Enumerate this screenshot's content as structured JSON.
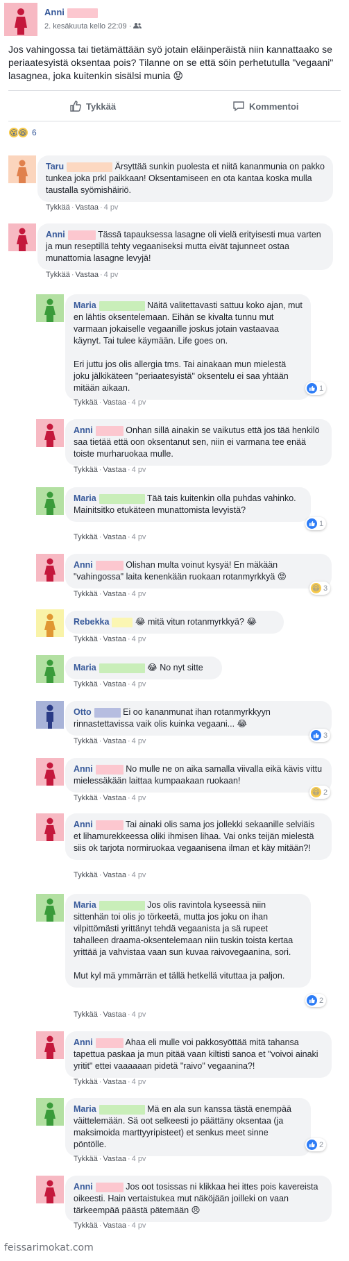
{
  "post": {
    "author": "Anni",
    "meta": "2. kesäkuuta kello 22:09 · ",
    "text": "Jos vahingossa tai tietämättään syö jotain eläinperäistä niin kannattaako se periaatesyistä oksentaa pois? Tilanne on se että söin perhetutulla \"vegaani\" lasagnea, joka kuitenkin sisälsi munia 😟",
    "like_label": "Tykkää",
    "comment_label": "Kommentoi",
    "reaction_count": "6"
  },
  "colors": {
    "link": "#365899",
    "bubble": "#f2f3f5",
    "avatar_female_bg": "#f7b9c3",
    "avatar_female_fig": "#c4183c",
    "avatar_green_bg": "#b3e0a2",
    "avatar_green_fig": "#3a9b3a",
    "avatar_orange_bg": "#fbd5bd",
    "avatar_orange_fig": "#e0814d",
    "avatar_yellow_bg": "#f9f3a8",
    "avatar_yellow_fig": "#e09733",
    "avatar_blue_bg": "#a8b3d8",
    "avatar_blue_fig": "#2a3b86"
  },
  "links": {
    "like": "Tykkää",
    "reply": "Vastaa",
    "sep": "·"
  },
  "comments": [
    {
      "name": "Taru",
      "text": "Ärsyttää sunkin puolesta et niitä kananmunia on pakko tunkea joka prkl paikkaan! Oksentamiseen en ota kantaa koska mulla taustalla syömishäiriö.",
      "age": "4 pv"
    },
    {
      "name": "Anni",
      "text": "Tässä tapauksessa lasagne oli vielä erityisesti mua varten ja mun reseptillä tehty vegaaniseksi mutta eivät tajunneet ostaa munattomia lasagne levyjä!",
      "age": "4 pv"
    },
    {
      "name": "Maria",
      "text": "Näitä valitettavasti sattuu koko ajan, mut en lähtis oksentelemaan. Eihän se kivalta tunnu mut varmaan jokaiselle vegaanille joskus jotain vastaavaa käynyt. Tai tulee käymään. Life goes on.",
      "text2": "Eri juttu jos olis allergia tms. Tai ainakaan mun mielestä joku jälkikäteen \"periaatesyistä\" oksentelu ei saa yhtään mitään aikaan.",
      "age": "4 pv",
      "reactions": "1"
    },
    {
      "name": "Anni",
      "text": "Onhan sillä ainakin se vaikutus että jos tää henkilö saa tietää että oon oksentanut sen, niin ei varmana tee enää toiste murharuokaa mulle.",
      "age": "4 pv"
    },
    {
      "name": "Maria",
      "text": "Tää tais kuitenkin olla puhdas vahinko. Mainitsitko etukäteen munattomista levyistä?",
      "age": "4 pv",
      "reactions": "1"
    },
    {
      "name": "Anni",
      "text": "Olishan multa voinut kysyä! En mäkään \"vahingossa\" laita kenenkään ruokaan rotanmyrkkyä 😡",
      "age": "4 pv",
      "reactions": "3"
    },
    {
      "name": "Rebekka",
      "text": "😂 mitä vitun rotanmyrkkyä? 😂",
      "age": "4 pv"
    },
    {
      "name": "Maria",
      "text": "😂 No nyt sitte",
      "age": "4 pv"
    },
    {
      "name": "Otto",
      "text": "Ei oo kananmunat ihan rotanmyrkkyyn rinnastettavissa vaik olis kuinka vegaani... 😂",
      "age": "4 pv",
      "reactions": "3"
    },
    {
      "name": "Anni",
      "text": "No mulle ne on aika samalla viivalla eikä kävis vittu mielessäkään laittaa kumpaakaan ruokaan!",
      "age": "4 pv",
      "reactions": "2"
    },
    {
      "name": "Anni",
      "text": "Tai ainaki olis sama jos jollekki sekaanille selviäis et lihamurekkeessa oliki ihmisen lihaa. Vai onks teijän mielestä siis ok tarjota normiruokaa vegaanisena ilman et käy mitään?!",
      "age": "4 pv"
    },
    {
      "name": "Maria",
      "text": "Jos olis ravintola kyseessä niin sittenhän toi olis jo törkeetä, mutta jos joku on ihan vilpittömästi yrittänyt tehdä vegaanista ja sä rupeet tahalleen draama-oksentelemaan niin tuskin toista kertaa yrittää ja vahvistaa vaan sun kuvaa raivovegaanina, sori.",
      "text2": "Mut kyl mä ymmärrän et tällä hetkellä vituttaa ja paljon.",
      "age": "4 pv",
      "reactions": "2"
    },
    {
      "name": "Anni",
      "text": "Ahaa eli mulle voi pakkosyöttää mitä tahansa tapettua paskaa ja mun pitää vaan kiltisti sanoa et \"voivoi ainaki yritit\" ettei vaaaaaan pidetä \"raivo\" vegaanina?!",
      "age": "4 pv"
    },
    {
      "name": "Maria",
      "text": "Mä en ala sun kanssa tästä enempää väittelemään. Sä oot selkeesti jo päättäny oksentaa (ja maksimoida marttyyripisteet) et senkus meet sinne pöntölle.",
      "age": "4 pv",
      "reactions": "2"
    },
    {
      "name": "Anni",
      "text": "Jos oot tosissas ni klikkaa hei ittes pois kavereista oikeesti. Hain vertaistukea mut näköjään joilleki on vaan tärkeempää päästä pätemään 😠",
      "age": "4 pv"
    }
  ],
  "watermark": "feissarimokat.com"
}
